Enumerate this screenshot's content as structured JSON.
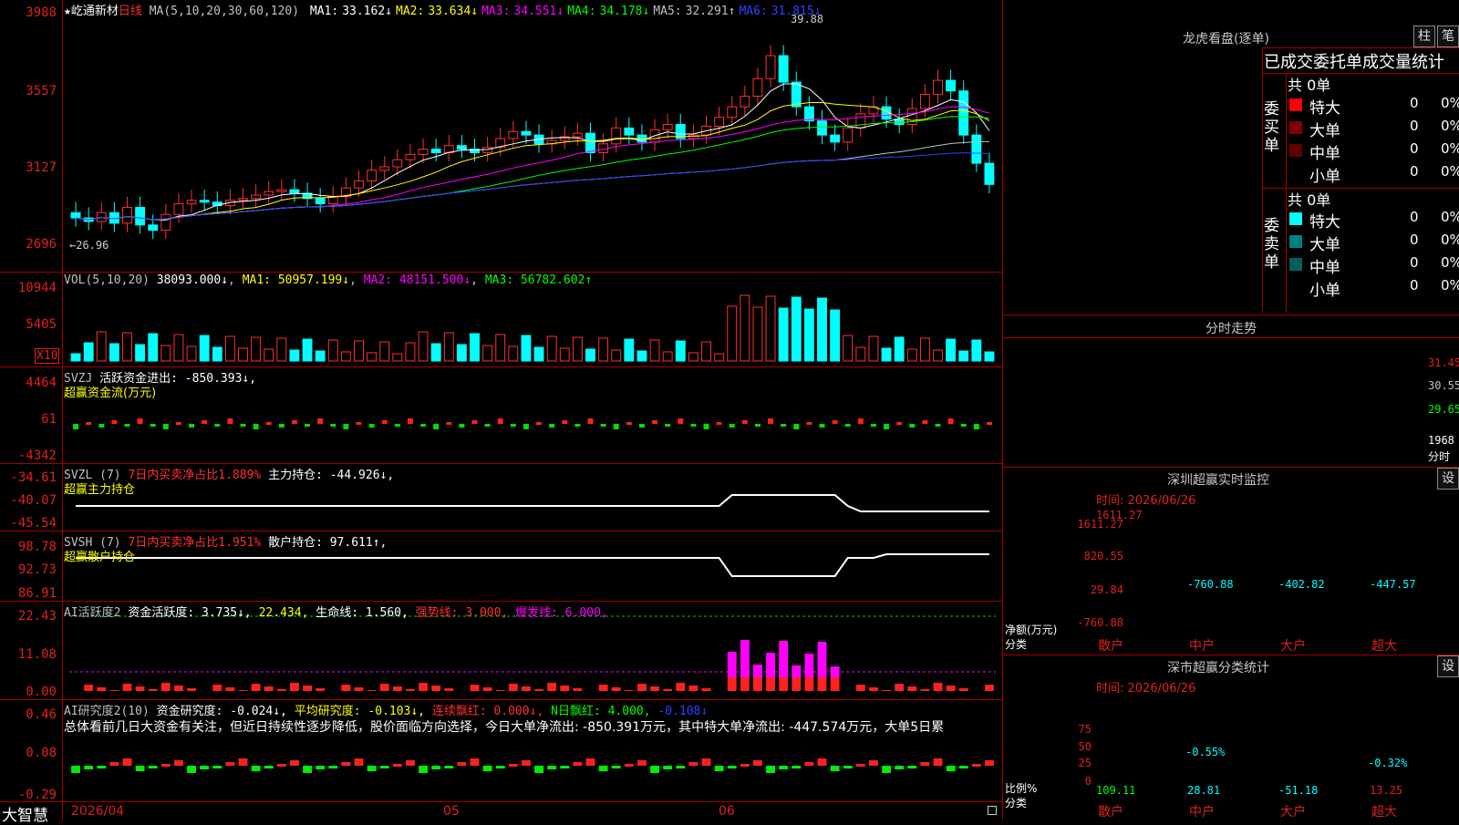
{
  "stock": {
    "star": "★",
    "name": "屹通新材",
    "period": "日线"
  },
  "ma_header": {
    "ma_label": "MA(5,10,20,30,60,120)",
    "items": [
      {
        "name": "MA1:",
        "value": "33.162↓",
        "color": "#ffffff"
      },
      {
        "name": "MA2:",
        "value": "33.634↓",
        "color": "#ffff00"
      },
      {
        "name": "MA3:",
        "value": "34.551↓",
        "color": "#ff00ff"
      },
      {
        "name": "MA4:",
        "value": "34.178↓",
        "color": "#00ff00"
      },
      {
        "name": "MA5:",
        "value": "32.291↑",
        "color": "#c0c0c0"
      },
      {
        "name": "MA6:",
        "value": "31.815↓",
        "color": "#3040ff"
      }
    ]
  },
  "price_axis": [
    "3988",
    "3557",
    "3127",
    "2696"
  ],
  "annot": {
    "high": "39.88",
    "low": "←26.96"
  },
  "vol": {
    "label": "VOL(5,10,20)",
    "value": "38093.000↓",
    "ma1": "MA1: 50957.199↓",
    "ma2": "MA2: 48151.500↓",
    "ma3": "MA3: 56782.602↑",
    "axis": [
      "10944",
      "5405"
    ],
    "unit": "X10"
  },
  "svzj": {
    "label": "SVZJ",
    "title": "活跃资金进出:",
    "value": "-850.393↓,",
    "sub": "超赢资金流(万元)",
    "axis": [
      "4464",
      "61",
      "-4342"
    ]
  },
  "svzl": {
    "label": "SVZL (7)",
    "t1": "7日内买卖净占比1.889%",
    "t2": "主力持仓:",
    "value": "-44.926↓,",
    "sub": "超赢主力持仓",
    "axis": [
      "-34.61",
      "-40.07",
      "-45.54"
    ]
  },
  "svsh": {
    "label": "SVSH (7)",
    "t1": "7日内买卖净占比1.951%",
    "t2": "散户持仓:",
    "value": "97.611↑,",
    "sub": "超赢散户持仓",
    "axis": [
      "98.78",
      "92.73",
      "86.91"
    ]
  },
  "ai1": {
    "label": "AI活跃度2",
    "t1": "资金活跃度:",
    "v1": "3.735↓,",
    "v2": "22.434,",
    "t3": "生命线:",
    "v3": "1.560,",
    "t4": "强势线: 3.000,",
    "t5": "爆发线: 6.000,",
    "axis": [
      "22.43",
      "11.08",
      "0.00"
    ]
  },
  "ai2": {
    "label": "AI研究度2(10)",
    "t1": "资金研究度:",
    "v1": "-0.024↓,",
    "t2": "平均研究度:",
    "v2": "-0.103↓,",
    "t3": "连续飘红: 0.000↓,",
    "t4": "N日飘红:",
    "v4": "4.000,",
    "v5": "-0.108↓",
    "axis": [
      "0.46",
      "0.08",
      "-0.29"
    ],
    "commentary": "总体看前几日大资金有关注，但近日持续性逐步降低，股价面临方向选择，今日大单净流出: -850.391万元，其中特大单净流出: -447.574万元，大单5日累"
  },
  "xaxis": {
    "d1": "2026/04",
    "d2": "05",
    "d3": "06"
  },
  "brand": "大智慧",
  "lhb": {
    "title": "龙虎看盘(逐单)",
    "btn1": "柱",
    "btn2": "笔",
    "header": "已成交委托单成交量统计",
    "buy": {
      "side": "委买单",
      "count": "共 0单",
      "rows": [
        {
          "name": "特大",
          "v": "0",
          "p": "0%",
          "color": "#ff0000"
        },
        {
          "name": "大单",
          "v": "0",
          "p": "0%",
          "color": "#800000"
        },
        {
          "name": "中单",
          "v": "0",
          "p": "0%",
          "color": "#600000"
        },
        {
          "name": "小单",
          "v": "0",
          "p": "0%",
          "color": "#000000"
        }
      ]
    },
    "sell": {
      "side": "委卖单",
      "count": "共 0单",
      "rows": [
        {
          "name": "特大",
          "v": "0",
          "p": "0%",
          "color": "#00ffff"
        },
        {
          "name": "大单",
          "v": "0",
          "p": "0%",
          "color": "#008080"
        },
        {
          "name": "中单",
          "v": "0",
          "p": "0%",
          "color": "#006060"
        },
        {
          "name": "小单",
          "v": "0",
          "p": "0%",
          "color": "#000000"
        }
      ]
    }
  },
  "fenshi": {
    "title": "分时走势",
    "axis": [
      "31.45",
      "30.55",
      "29.65"
    ],
    "vol": "1968",
    "vol_label": "分时"
  },
  "monitor": {
    "title": "深圳超赢实时监控",
    "btn": "设",
    "time": "时间: 2026/06/26",
    "axis": [
      "1611.27",
      "820.55",
      "29.84",
      "-760.88"
    ],
    "values": [
      "1611.27",
      "-760.88",
      "-402.82",
      "-447.57"
    ],
    "cats": [
      "散户",
      "中户",
      "大户",
      "超大"
    ],
    "unit": "净额(万元)",
    "cat_label": "分类"
  },
  "classstat": {
    "title": "深市超赢分类统计",
    "btn": "设",
    "time": "时间: 2026/06/26",
    "axis": [
      "75",
      "50",
      "25",
      "0"
    ],
    "pct": [
      "-0.55%",
      "-0.32%"
    ],
    "values": [
      "109.11",
      "28.81",
      "-51.18",
      "13.25"
    ],
    "cats": [
      "散户",
      "中户",
      "大户",
      "超大"
    ],
    "unit": "比例%",
    "cat_label": "分类"
  },
  "chart_data": {
    "type": "candlestick",
    "title": "屹通新材 日线",
    "ylim": [
      26.96,
      39.88
    ]
  }
}
